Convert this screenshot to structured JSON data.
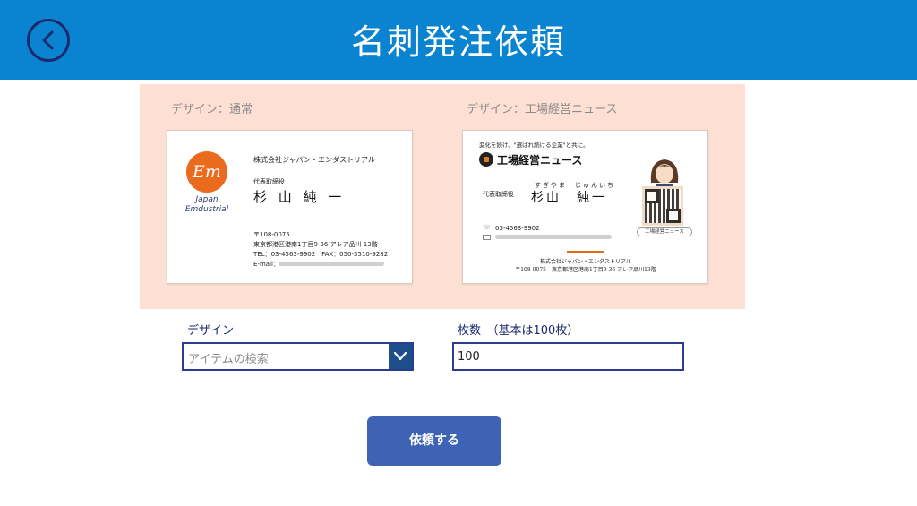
{
  "header": {
    "title": "名刺発注依頼",
    "back_icon": "chevron-left-icon"
  },
  "preview": {
    "cards": [
      {
        "caption": "デザイン：通常",
        "logo_mark": "Em",
        "logo_text_1": "Japan",
        "logo_text_2": "Emdustrial",
        "company": "株式会社ジャパン・エンダストリアル",
        "role": "代表取締役",
        "name": "杉 山 純 一",
        "postal": "〒108-0075",
        "address": "東京都港区港南1丁目9-36 アレア品川 13階",
        "tel_fax": "TEL：03-4563-9902　FAX：050-3510-9282",
        "email_label": "E-mail："
      },
      {
        "caption": "デザイン：工場経営ニュース",
        "tagline": "変化を続け、\"選ばれ続ける企業\"と共に。",
        "brand": "工場経営ニュース",
        "name_kana": "すぎやま　じゅんいち",
        "role": "代表取締役",
        "name": "杉山　純一",
        "phone": "03-4563-9902",
        "qr_label": "工場経営ニュース",
        "footer_company": "株式会社ジャパン・エンダストリアル",
        "footer_address": "〒108-0075　東京都港区港南1丁目9-36 アレア品川13階"
      }
    ]
  },
  "form": {
    "design_label": "デザイン",
    "design_placeholder": "アイテムの検索",
    "count_label": "枚数　（基本は100枚）",
    "count_value": "100",
    "submit_label": "依頼する"
  },
  "colors": {
    "header": "#0a84d0",
    "panel": "#fde0d3",
    "accent": "#ea6a1e",
    "button": "#3e62b4",
    "border": "#2b3b8e"
  }
}
